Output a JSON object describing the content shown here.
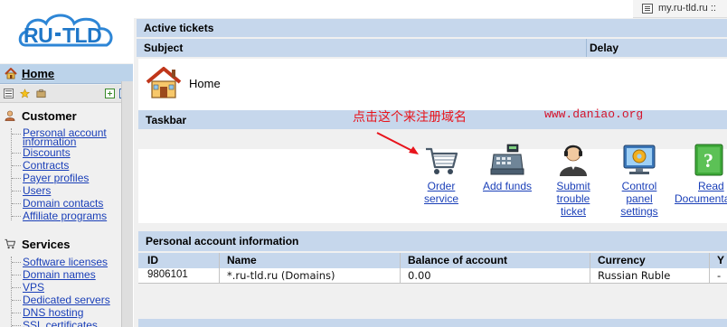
{
  "topbar": {
    "url_text": "my.ru-tld.ru ::"
  },
  "logo": {
    "text": "RU-TLD"
  },
  "sidebar": {
    "home": {
      "label": "Home"
    },
    "sections": [
      {
        "label": "Customer",
        "links": [
          "Personal account information",
          "Discounts",
          "Contracts",
          "Payer profiles",
          "Users",
          "Domain contacts",
          "Affiliate programs"
        ]
      },
      {
        "label": "Services",
        "links": [
          "Software licenses",
          "Domain names",
          "VPS",
          "Dedicated servers",
          "DNS hosting",
          "SSL certificates"
        ]
      }
    ]
  },
  "main": {
    "active_tickets": {
      "title": "Active tickets",
      "col_subject": "Subject",
      "col_delay": "Delay"
    },
    "home_title": "Home",
    "taskbar": {
      "title": "Taskbar",
      "items": [
        {
          "label_lines": [
            "Order",
            "service"
          ],
          "icon": "shopping-cart-icon"
        },
        {
          "label_lines": [
            "Add funds"
          ],
          "icon": "cash-register-icon"
        },
        {
          "label_lines": [
            "Submit",
            "trouble",
            "ticket"
          ],
          "icon": "support-operator-icon"
        },
        {
          "label_lines": [
            "Control",
            "panel",
            "settings"
          ],
          "icon": "monitor-settings-icon"
        },
        {
          "label_lines": [
            "Read",
            "Documenta"
          ],
          "icon": "book-icon"
        }
      ]
    },
    "annotation": {
      "chinese_note": "点击这个来注册域名",
      "watermark": "www.daniao.org"
    },
    "account_info": {
      "title": "Personal account information",
      "columns": [
        "ID",
        "Name",
        "Balance of account",
        "Currency",
        "Y"
      ],
      "rows": [
        [
          "9806101",
          "*.ru-tld.ru (Domains)",
          "0.00",
          "Russian Ruble",
          "-"
        ]
      ]
    }
  },
  "colors": {
    "panel_header": "#c6d7ec",
    "link": "#1a3fb8",
    "annotation_red": "#e8141c",
    "logo_blue": "#1f77c8"
  }
}
